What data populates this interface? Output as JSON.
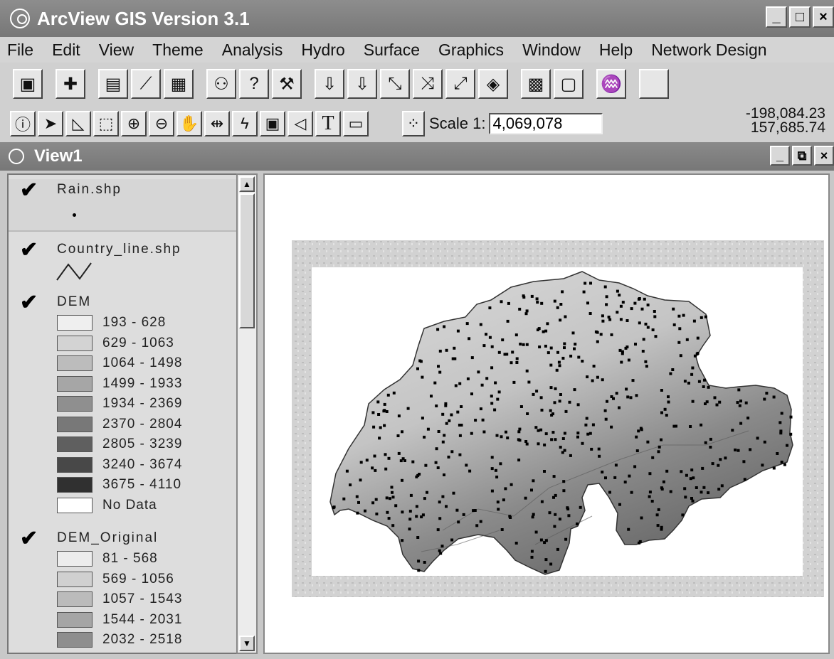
{
  "app": {
    "title": "ArcView GIS Version 3.1"
  },
  "window_buttons": [
    "_",
    "□",
    "×"
  ],
  "menu": [
    "File",
    "Edit",
    "View",
    "Theme",
    "Analysis",
    "Hydro",
    "Surface",
    "Graphics",
    "Window",
    "Help",
    "Network Design"
  ],
  "toolbar": {
    "scale_label": "Scale 1:",
    "scale_value": "4,069,078",
    "coord_x": "-198,084.23",
    "coord_y": "157,685.74"
  },
  "view": {
    "title": "View1"
  },
  "layers": {
    "rain": {
      "name": "Rain.shp"
    },
    "country": {
      "name": "Country_line.shp"
    },
    "dem": {
      "name": "DEM",
      "classes": [
        {
          "label": "193 - 628",
          "color": "#efefef"
        },
        {
          "label": "629 - 1063",
          "color": "#d3d3d3"
        },
        {
          "label": "1064 - 1498",
          "color": "#bcbcbc"
        },
        {
          "label": "1499 - 1933",
          "color": "#a6a6a6"
        },
        {
          "label": "1934 - 2369",
          "color": "#8f8f8f"
        },
        {
          "label": "2370 - 2804",
          "color": "#787878"
        },
        {
          "label": "2805 - 3239",
          "color": "#5f5f5f"
        },
        {
          "label": "3240 - 3674",
          "color": "#484848"
        },
        {
          "label": "3675 - 4110",
          "color": "#303030"
        },
        {
          "label": "No Data",
          "color": "#ffffff"
        }
      ]
    },
    "dem_original": {
      "name": "DEM_Original",
      "classes": [
        {
          "label": "81 - 568",
          "color": "#ececec"
        },
        {
          "label": "569 - 1056",
          "color": "#d0d0d0"
        },
        {
          "label": "1057 - 1543",
          "color": "#bbbbbb"
        },
        {
          "label": "1544 - 2031",
          "color": "#a5a5a5"
        },
        {
          "label": "2032 - 2518",
          "color": "#8e8e8e"
        }
      ]
    }
  }
}
